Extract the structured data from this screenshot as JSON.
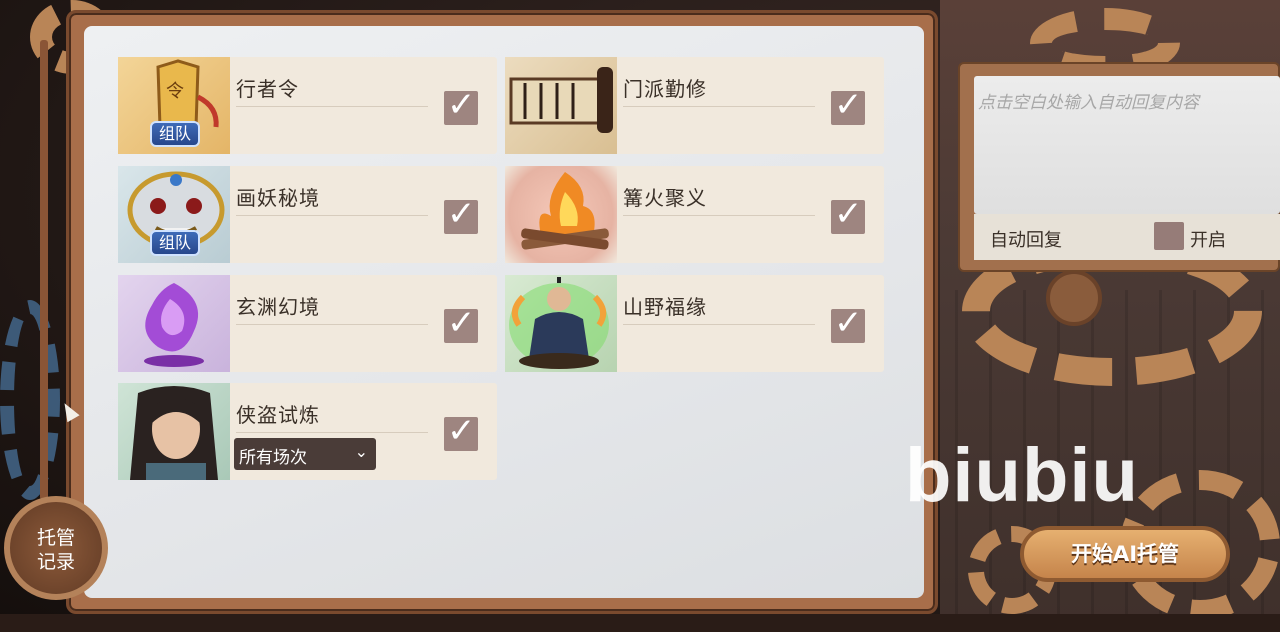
{
  "activities": [
    {
      "title": "行者令",
      "badge": "组队",
      "checked": true
    },
    {
      "title": "门派勤修",
      "badge": "",
      "checked": true
    },
    {
      "title": "画妖秘境",
      "badge": "组队",
      "checked": true
    },
    {
      "title": "篝火聚义",
      "badge": "",
      "checked": true
    },
    {
      "title": "玄渊幻境",
      "badge": "",
      "checked": true
    },
    {
      "title": "山野福缘",
      "badge": "",
      "checked": true
    },
    {
      "title": "侠盗试炼",
      "badge": "",
      "checked": true,
      "dropdown": "所有场次"
    }
  ],
  "check_glyph": "✓",
  "dropdown_chevron": "⌄",
  "auto_reply": {
    "placeholder": "点击空白处输入自动回复内容",
    "label": "自动回复",
    "toggle_label": "开启",
    "enabled": false
  },
  "start_button": "开始AI托管",
  "records_button": {
    "line1": "托管",
    "line2": "记录"
  },
  "watermark": "biubiu",
  "colors": {
    "panel_bg": "#e8eaed",
    "card_bg": "#f1e9dd",
    "frame": "#a86e4a",
    "checkbox": "#9e8580",
    "accent": "#c5844b"
  }
}
